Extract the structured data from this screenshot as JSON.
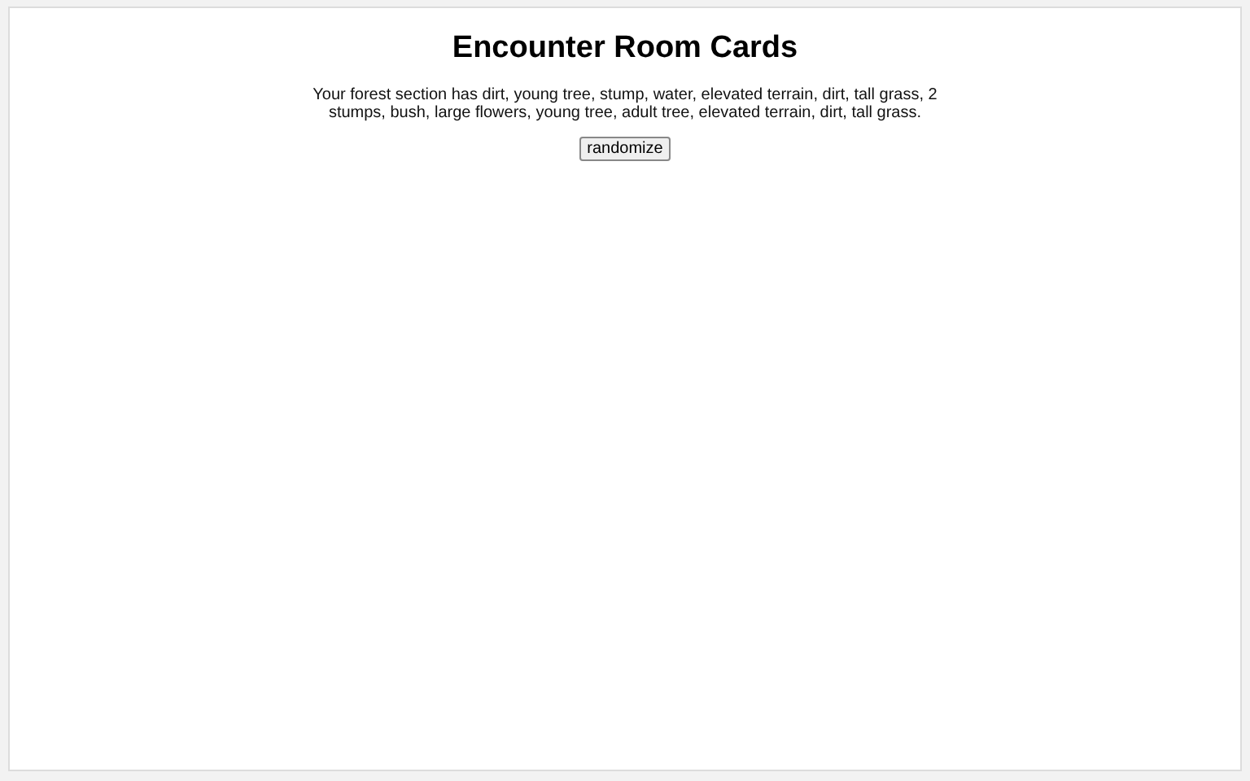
{
  "title": "Encounter Room Cards",
  "description": "Your forest section has dirt, young tree, stump, water, elevated terrain, dirt, tall grass, 2 stumps, bush, large flowers, young tree, adult tree, elevated terrain, dirt, tall grass.",
  "button": "randomize"
}
